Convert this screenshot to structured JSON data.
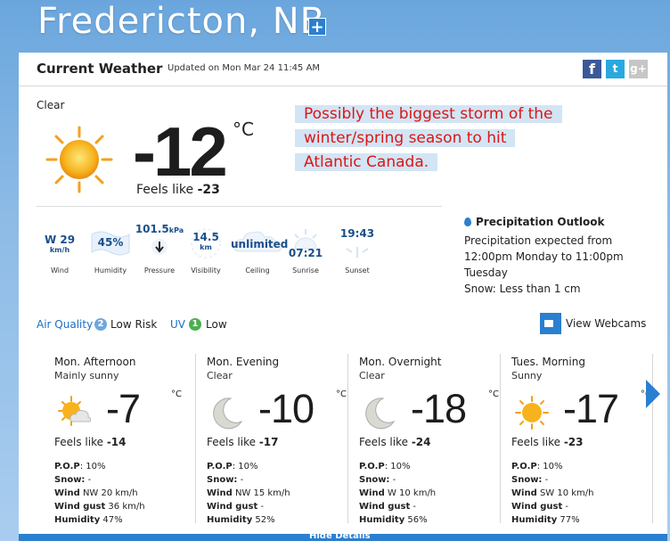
{
  "location": {
    "title": "Fredericton, NB",
    "add_symbol": "+"
  },
  "current": {
    "header_title": "Current Weather",
    "updated": "Updated on Mon Mar 24 11:45 AM",
    "social": [
      "f",
      "t",
      "g+"
    ],
    "condition": "Clear",
    "icon": "sun-icon",
    "temperature": "-12",
    "unit": "°C",
    "feels_like_label": "Feels like ",
    "feels_like_value": "-23"
  },
  "annotation": {
    "lines": [
      "Possibly the biggest storm of the",
      "winter/spring season to hit",
      "Atlantic Canada."
    ],
    "color": "#e01414"
  },
  "stats": [
    {
      "id": "wind",
      "value": "W 29",
      "unit": "km/h",
      "label": "Wind"
    },
    {
      "id": "humidity",
      "value": "45%",
      "label": "Humidity"
    },
    {
      "id": "pressure",
      "value": "101.5",
      "unit": "kPa",
      "label": "Pressure"
    },
    {
      "id": "visibility",
      "value": "14.5",
      "unit": "km",
      "label": "Visibility"
    },
    {
      "id": "ceiling",
      "value": "unlimited",
      "label": "Ceiling"
    },
    {
      "id": "sunrise",
      "value": "07:21",
      "label": "Sunrise"
    },
    {
      "id": "sunset",
      "value": "19:43",
      "label": "Sunset"
    }
  ],
  "precipitation": {
    "title": "Precipitation Outlook",
    "line1": "Precipitation expected from",
    "line2": "12:00pm Monday to 11:00pm",
    "line3": "Tuesday",
    "line4": "Snow: Less than 1 cm"
  },
  "air_quality": {
    "label": "Air Quality",
    "index": "2",
    "risk": "Low Risk",
    "uv_label": "UV",
    "uv_index": "1",
    "uv_text": "Low"
  },
  "webcams_label": "View Webcams",
  "forecast": [
    {
      "period": "Mon. Afternoon",
      "condition": "Mainly sunny",
      "icon": "sun-cloud-icon",
      "temp": "-7",
      "unit": "°C",
      "feels": "-14",
      "pop": "10%",
      "snow": "-",
      "wind": "NW 20 km/h",
      "wind_gust": "36 km/h",
      "humidity": "47%"
    },
    {
      "period": "Mon. Evening",
      "condition": "Clear",
      "icon": "moon-icon",
      "temp": "-10",
      "unit": "°C",
      "feels": "-17",
      "pop": "10%",
      "snow": "-",
      "wind": "NW 15 km/h",
      "wind_gust": "-",
      "humidity": "52%"
    },
    {
      "period": "Mon. Overnight",
      "condition": "Clear",
      "icon": "moon-icon",
      "temp": "-18",
      "unit": "°C",
      "feels": "-24",
      "pop": "10%",
      "snow": "-",
      "wind": "W 10 km/h",
      "wind_gust": "-",
      "humidity": "56%"
    },
    {
      "period": "Tues. Morning",
      "condition": "Sunny",
      "icon": "sun-icon",
      "temp": "-17",
      "unit": "°C",
      "feels": "-23",
      "pop": "10%",
      "snow": "-",
      "wind": "SW 10 km/h",
      "wind_gust": "-",
      "humidity": "77%"
    }
  ],
  "labels": {
    "feels_like": "Feels like ",
    "pop": "P.O.P",
    "snow": "Snow:",
    "wind": "Wind",
    "wind_gust": "Wind gust",
    "humidity": "Humidity"
  },
  "hide_details": "Hide Details"
}
